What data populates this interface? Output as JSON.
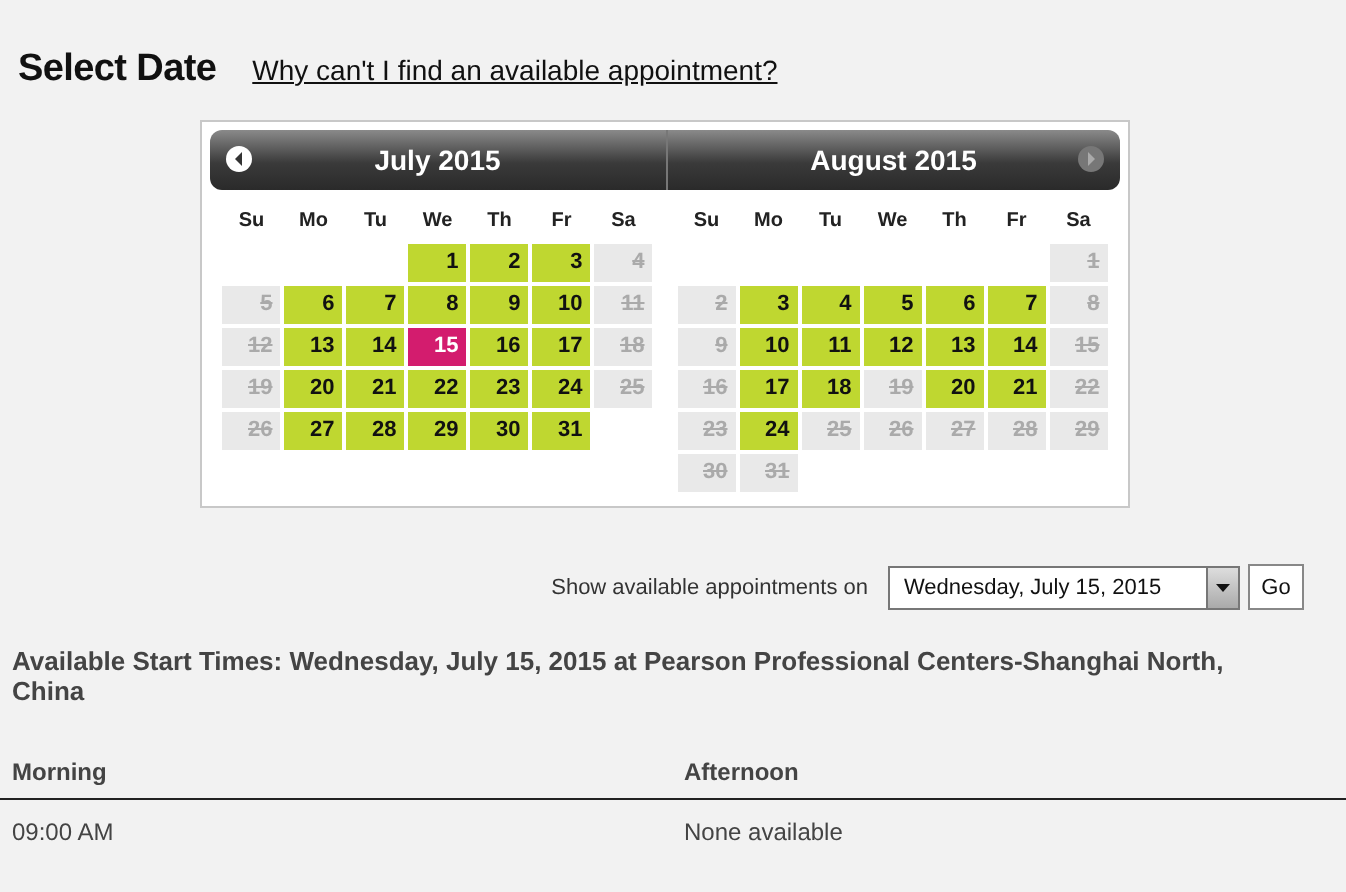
{
  "title": "Select Date",
  "help_link": "Why can't I find an available appointment?",
  "calendar": {
    "months": [
      {
        "title": "July 2015",
        "nav": {
          "kind": "prev",
          "disabled": false
        },
        "weekdays": [
          "Su",
          "Mo",
          "Tu",
          "We",
          "Th",
          "Fr",
          "Sa"
        ],
        "weeks": [
          {
            "days": [
              {
                "day": "1",
                "available": true,
                "selected": false
              },
              {
                "day": "2",
                "available": true,
                "selected": false
              },
              {
                "day": "3",
                "available": true,
                "selected": false
              },
              {
                "day": "4",
                "available": false,
                "selected": false
              }
            ]
          },
          {
            "days": [
              {
                "day": "5",
                "available": false,
                "selected": false
              },
              {
                "day": "6",
                "available": true,
                "selected": false
              },
              {
                "day": "7",
                "available": true,
                "selected": false
              },
              {
                "day": "8",
                "available": true,
                "selected": false
              },
              {
                "day": "9",
                "available": true,
                "selected": false
              },
              {
                "day": "10",
                "available": true,
                "selected": false
              },
              {
                "day": "11",
                "available": false,
                "selected": false
              }
            ]
          },
          {
            "days": [
              {
                "day": "12",
                "available": false,
                "selected": false
              },
              {
                "day": "13",
                "available": true,
                "selected": false
              },
              {
                "day": "14",
                "available": true,
                "selected": false
              },
              {
                "day": "15",
                "available": true,
                "selected": true
              },
              {
                "day": "16",
                "available": true,
                "selected": false
              },
              {
                "day": "17",
                "available": true,
                "selected": false
              },
              {
                "day": "18",
                "available": false,
                "selected": false
              }
            ]
          },
          {
            "days": [
              {
                "day": "19",
                "available": false,
                "selected": false
              },
              {
                "day": "20",
                "available": true,
                "selected": false
              },
              {
                "day": "21",
                "available": true,
                "selected": false
              },
              {
                "day": "22",
                "available": true,
                "selected": false
              },
              {
                "day": "23",
                "available": true,
                "selected": false
              },
              {
                "day": "24",
                "available": true,
                "selected": false
              },
              {
                "day": "25",
                "available": false,
                "selected": false
              }
            ]
          },
          {
            "days": [
              {
                "day": "26",
                "available": false,
                "selected": false
              },
              {
                "day": "27",
                "available": true,
                "selected": false
              },
              {
                "day": "28",
                "available": true,
                "selected": false
              },
              {
                "day": "29",
                "available": true,
                "selected": false
              },
              {
                "day": "30",
                "available": true,
                "selected": false
              },
              {
                "day": "31",
                "available": true,
                "selected": false
              }
            ]
          }
        ]
      },
      {
        "title": "August 2015",
        "nav": {
          "kind": "next",
          "disabled": true
        },
        "weekdays": [
          "Su",
          "Mo",
          "Tu",
          "We",
          "Th",
          "Fr",
          "Sa"
        ],
        "weeks": [
          {
            "days": [
              {
                "day": "1",
                "available": false,
                "selected": false
              }
            ]
          },
          {
            "days": [
              {
                "day": "2",
                "available": false,
                "selected": false
              },
              {
                "day": "3",
                "available": true,
                "selected": false
              },
              {
                "day": "4",
                "available": true,
                "selected": false
              },
              {
                "day": "5",
                "available": true,
                "selected": false
              },
              {
                "day": "6",
                "available": true,
                "selected": false
              },
              {
                "day": "7",
                "available": true,
                "selected": false
              },
              {
                "day": "8",
                "available": false,
                "selected": false
              }
            ]
          },
          {
            "days": [
              {
                "day": "9",
                "available": false,
                "selected": false
              },
              {
                "day": "10",
                "available": true,
                "selected": false
              },
              {
                "day": "11",
                "available": true,
                "selected": false
              },
              {
                "day": "12",
                "available": true,
                "selected": false
              },
              {
                "day": "13",
                "available": true,
                "selected": false
              },
              {
                "day": "14",
                "available": true,
                "selected": false
              },
              {
                "day": "15",
                "available": false,
                "selected": false
              }
            ]
          },
          {
            "days": [
              {
                "day": "16",
                "available": false,
                "selected": false
              },
              {
                "day": "17",
                "available": true,
                "selected": false
              },
              {
                "day": "18",
                "available": true,
                "selected": false
              },
              {
                "day": "19",
                "available": false,
                "selected": false
              },
              {
                "day": "20",
                "available": true,
                "selected": false
              },
              {
                "day": "21",
                "available": true,
                "selected": false
              },
              {
                "day": "22",
                "available": false,
                "selected": false
              }
            ]
          },
          {
            "days": [
              {
                "day": "23",
                "available": false,
                "selected": false
              },
              {
                "day": "24",
                "available": true,
                "selected": false
              },
              {
                "day": "25",
                "available": false,
                "selected": false
              },
              {
                "day": "26",
                "available": false,
                "selected": false
              },
              {
                "day": "27",
                "available": false,
                "selected": false
              },
              {
                "day": "28",
                "available": false,
                "selected": false
              },
              {
                "day": "29",
                "available": false,
                "selected": false
              }
            ]
          },
          {
            "days": [
              {
                "day": "30",
                "available": false,
                "selected": false
              },
              {
                "day": "31",
                "available": false,
                "selected": false
              }
            ]
          }
        ]
      }
    ]
  },
  "date_picker": {
    "label": "Show available appointments on",
    "value": "Wednesday, July 15, 2015",
    "button": "Go"
  },
  "heading": "Available Start Times: Wednesday, July 15, 2015 at Pearson Professional Centers-Shanghai North, China",
  "table": {
    "columns": [
      "Morning",
      "Afternoon"
    ],
    "rows": [
      [
        "09:00 AM",
        "None available"
      ]
    ]
  }
}
